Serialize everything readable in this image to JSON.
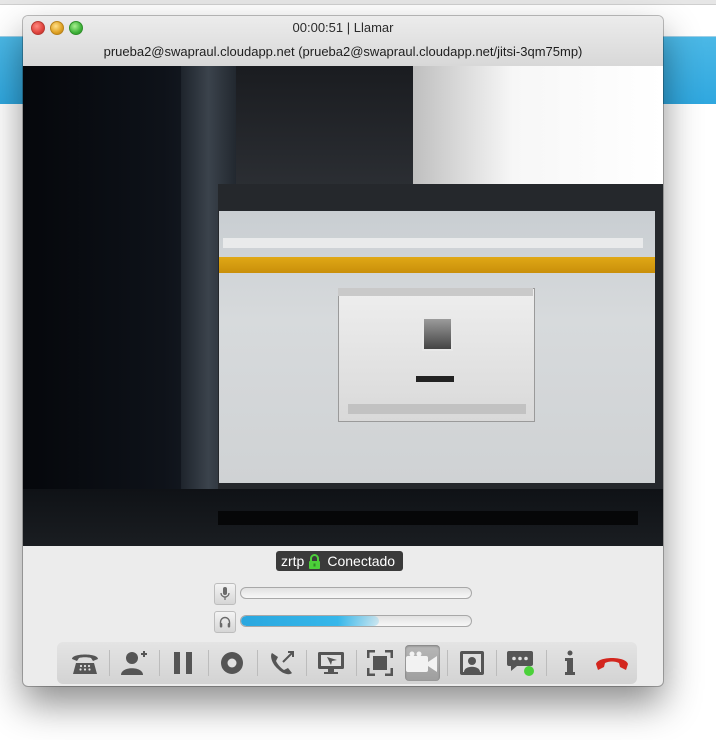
{
  "window": {
    "title": "00:00:51 | Llamar",
    "subtitle": "prueba2@swapraul.cloudapp.net (prueba2@swapraul.cloudapp.net/jitsi-3qm75mp)"
  },
  "status": {
    "protocol": "zrtp",
    "state": "Conectado"
  },
  "meters": {
    "microphone_level": 0.0,
    "speaker_level": 0.6
  },
  "toolbar": {
    "buttons": [
      {
        "icon": "dialpad-icon",
        "active": false
      },
      {
        "icon": "add-participant-icon",
        "active": false
      },
      {
        "icon": "hold-icon",
        "active": false
      },
      {
        "icon": "record-icon",
        "active": false
      },
      {
        "icon": "transfer-icon",
        "active": false
      },
      {
        "icon": "desktop-sharing-icon",
        "active": false
      },
      {
        "icon": "fullscreen-icon",
        "active": false
      },
      {
        "icon": "video-icon",
        "active": true
      },
      {
        "icon": "local-video-icon",
        "active": false
      },
      {
        "icon": "chat-icon",
        "active": false
      },
      {
        "icon": "info-icon",
        "active": false
      },
      {
        "icon": "hangup-icon",
        "active": false
      }
    ]
  },
  "colors": {
    "accent_blue": "#2fa7df",
    "hangup_red": "#d3261e",
    "lock_green": "#4ccf3a",
    "chat_badge_green": "#4bd13a"
  }
}
